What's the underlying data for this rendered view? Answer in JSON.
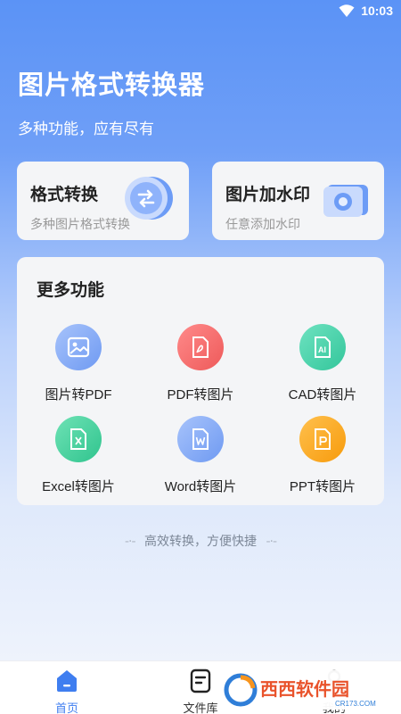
{
  "status_bar": {
    "time": "10:03"
  },
  "header": {
    "title": "图片格式转换器",
    "subtitle": "多种功能，应有尽有"
  },
  "feature_cards": [
    {
      "title": "格式转换",
      "desc": "多种图片格式转换",
      "icon": "format-convert-icon"
    },
    {
      "title": "图片加水印",
      "desc": "任意添加水印",
      "icon": "camera-icon"
    }
  ],
  "more_section": {
    "title": "更多功能",
    "items": [
      {
        "label": "图片转PDF",
        "icon": "image-icon"
      },
      {
        "label": "PDF转图片",
        "icon": "pdf-icon"
      },
      {
        "label": "CAD转图片",
        "icon": "cad-icon"
      },
      {
        "label": "Excel转图片",
        "icon": "excel-icon"
      },
      {
        "label": "Word转图片",
        "icon": "word-icon"
      },
      {
        "label": "PPT转图片",
        "icon": "ppt-icon"
      }
    ]
  },
  "slogan": {
    "text": "高效转换，方便快捷",
    "left_dash": "-·-",
    "right_dash": "-·-"
  },
  "bottom_nav": {
    "items": [
      {
        "label": "首页",
        "icon": "home-icon",
        "active": true
      },
      {
        "label": "文件库",
        "icon": "file-library-icon",
        "active": false
      },
      {
        "label": "我的",
        "icon": "user-icon",
        "active": false
      }
    ]
  },
  "watermark": {
    "text": "西西软件园",
    "sub": "CR173.COM"
  },
  "colors": {
    "accent": "#3f7ef0",
    "header_bg": "#5b93f6"
  }
}
